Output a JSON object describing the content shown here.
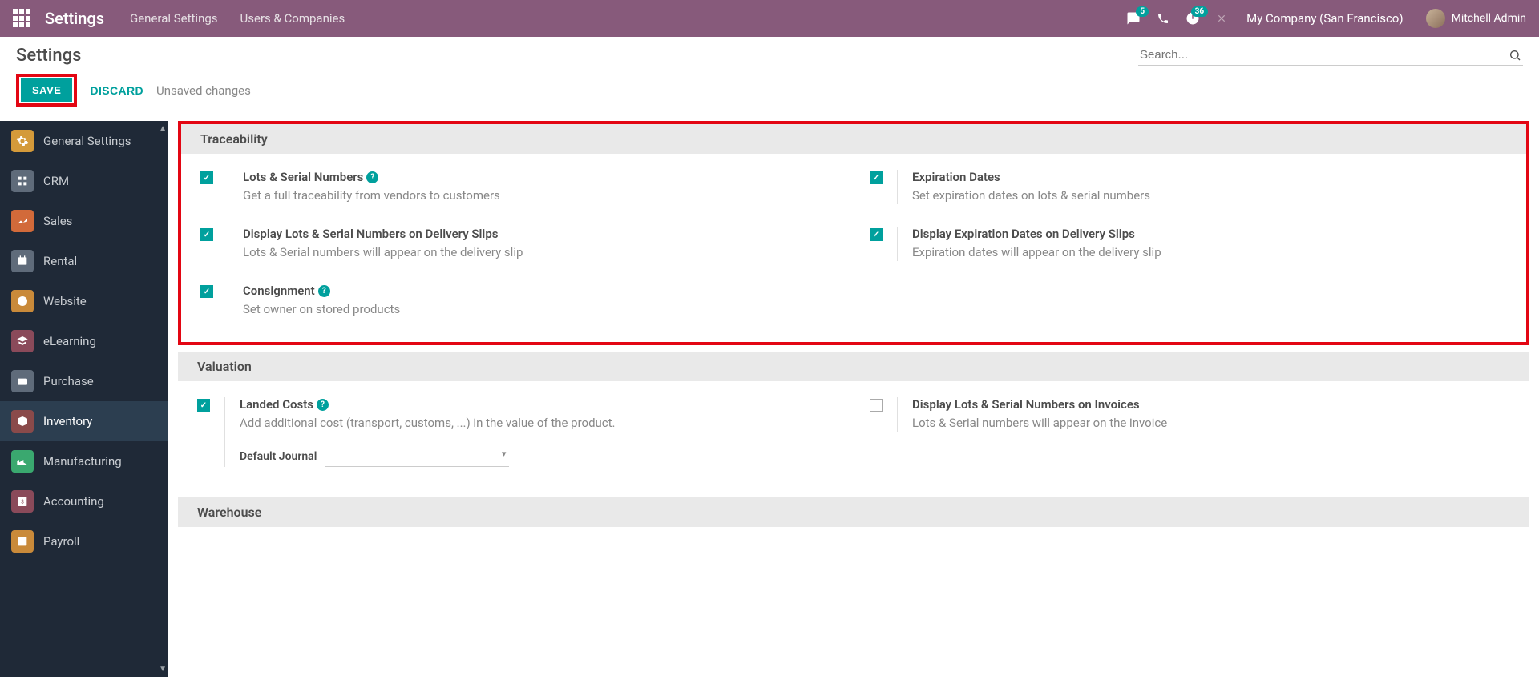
{
  "navbar": {
    "brand": "Settings",
    "links": [
      "General Settings",
      "Users & Companies"
    ],
    "messages_badge": "5",
    "activities_badge": "36",
    "company": "My Company (San Francisco)",
    "user": "Mitchell Admin"
  },
  "subheader": {
    "title": "Settings",
    "search_placeholder": "Search..."
  },
  "actions": {
    "save": "SAVE",
    "discard": "DISCARD",
    "unsaved": "Unsaved changes"
  },
  "sidebar": [
    {
      "label": "General Settings",
      "color": "#d49a3a"
    },
    {
      "label": "CRM",
      "color": "#5f6b7a"
    },
    {
      "label": "Sales",
      "color": "#d26a3a"
    },
    {
      "label": "Rental",
      "color": "#5f6b7a"
    },
    {
      "label": "Website",
      "color": "#c98a3a"
    },
    {
      "label": "eLearning",
      "color": "#8a4a5a"
    },
    {
      "label": "Purchase",
      "color": "#5f6b7a"
    },
    {
      "label": "Inventory",
      "color": "#8a4a4a",
      "active": true
    },
    {
      "label": "Manufacturing",
      "color": "#3aa86f"
    },
    {
      "label": "Accounting",
      "color": "#8a4a5a"
    },
    {
      "label": "Payroll",
      "color": "#c98a3a"
    }
  ],
  "sections": {
    "traceability": {
      "title": "Traceability",
      "left": [
        {
          "title": "Lots & Serial Numbers",
          "desc": "Get a full traceability from vendors to customers",
          "help": true,
          "checked": true
        },
        {
          "title": "Display Lots & Serial Numbers on Delivery Slips",
          "desc": "Lots & Serial numbers will appear on the delivery slip",
          "help": false,
          "checked": true
        },
        {
          "title": "Consignment",
          "desc": "Set owner on stored products",
          "help": true,
          "checked": true
        }
      ],
      "right": [
        {
          "title": "Expiration Dates",
          "desc": "Set expiration dates on lots & serial numbers",
          "help": false,
          "checked": true
        },
        {
          "title": "Display Expiration Dates on Delivery Slips",
          "desc": "Expiration dates will appear on the delivery slip",
          "help": false,
          "checked": true
        }
      ]
    },
    "valuation": {
      "title": "Valuation",
      "left": [
        {
          "title": "Landed Costs",
          "desc": "Add additional cost (transport, customs, ...) in the value of the product.",
          "help": true,
          "checked": true,
          "journal": true
        }
      ],
      "right": [
        {
          "title": "Display Lots & Serial Numbers on Invoices",
          "desc": "Lots & Serial numbers will appear on the invoice",
          "help": false,
          "checked": false
        }
      ],
      "journal_label": "Default Journal"
    },
    "warehouse": {
      "title": "Warehouse"
    }
  }
}
